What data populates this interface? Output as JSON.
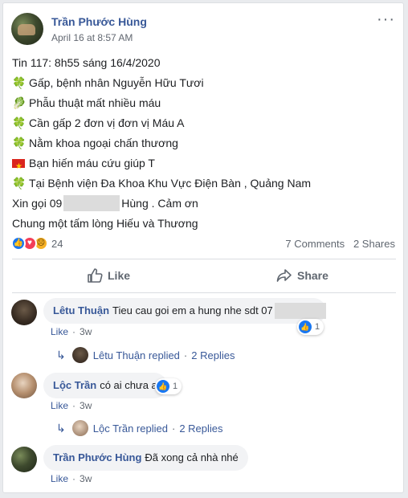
{
  "post": {
    "author": "Trần Phước Hùng",
    "timestamp": "April 16 at 8:57 AM",
    "more_icon": "···",
    "lines": {
      "l0": "Tin 117: 8h55 sáng 16/4/2020",
      "l1": "Gấp, bệnh nhân Nguyễn Hữu Tươi",
      "l2": "Phẫu thuật mất nhiều máu",
      "l3": "Cần gấp 2 đơn vị đơn vị Máu A",
      "l4": "Nằm khoa ngoại chấn thương",
      "l5": "Bạn hiến máu cứu giúp T",
      "l6": "Tại Bệnh viện Đa Khoa Khu Vực Điện Bàn , Quảng Nam",
      "l7a": "Xin gọi 09",
      "l7b": "Hùng . Cảm ơn",
      "l8": "Chung một tấm lòng Hiếu và Thương"
    },
    "emoji": {
      "clover": "🍀",
      "leaf": "🥬"
    }
  },
  "stats": {
    "reaction_count": "24",
    "comments": "7 Comments",
    "shares": "2 Shares",
    "reaction_icons": [
      "like-icon",
      "love-icon",
      "sad-icon"
    ]
  },
  "actions": {
    "like": "Like",
    "share": "Share"
  },
  "comments": [
    {
      "author": "Lêtu Thuận",
      "text": "Tieu cau goi em a hung nhe sdt 07",
      "like_label": "Like",
      "age": "3w",
      "reaction_count": "1",
      "reply_author": "Lêtu Thuận replied",
      "reply_count": "2 Replies"
    },
    {
      "author": "Lộc Trần",
      "text": "có ai chưa a",
      "like_label": "Like",
      "age": "3w",
      "reaction_count": "1",
      "reply_author": "Lộc Trần replied",
      "reply_count": "2 Replies"
    },
    {
      "author": "Trần Phước Hùng",
      "text": "Đã xong cả nhà nhé",
      "like_label": "Like",
      "age": "3w"
    }
  ],
  "colors": {
    "link": "#385898",
    "muted": "#606770",
    "like_blue": "#1877f2",
    "bubble": "#f2f3f5"
  }
}
